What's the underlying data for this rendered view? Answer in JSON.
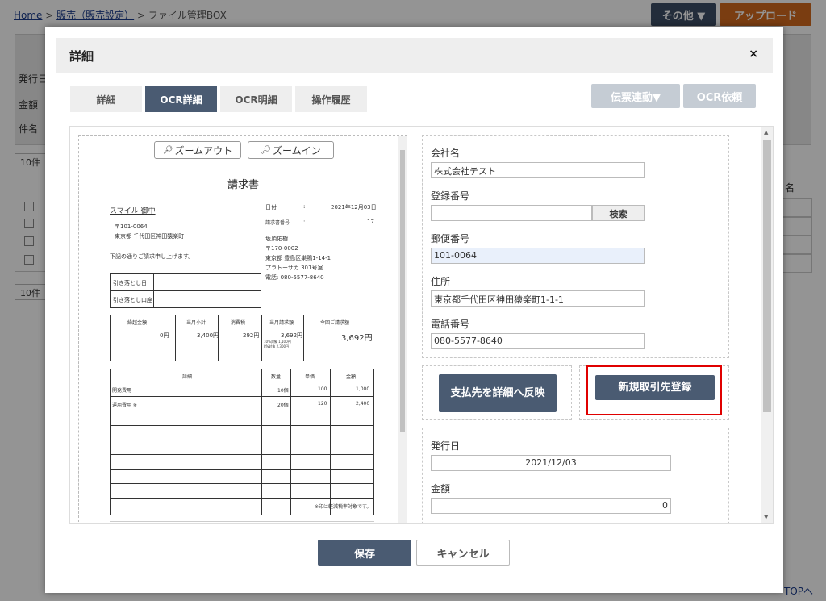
{
  "breadcrumb": {
    "home": "Home",
    "sep1": ">",
    "sales": "販売（販売設定）",
    "sep2": ">",
    "current": "ファイル管理BOX"
  },
  "header_buttons": {
    "other": "その他 ▼",
    "upload": "アップロード"
  },
  "background": {
    "labels": [
      "発行日",
      "金額",
      "件名"
    ],
    "per_page": "10件",
    "per_page2": "10件",
    "col_partial": "名",
    "to_top": "TOPへ"
  },
  "modal": {
    "title": "詳細",
    "close": "×",
    "tabs": [
      {
        "label": "詳細",
        "active": false
      },
      {
        "label": "OCR詳細",
        "active": true
      },
      {
        "label": "OCR明細",
        "active": false
      },
      {
        "label": "操作履歴",
        "active": false
      }
    ],
    "actions": {
      "link_slip": "伝票連動▼",
      "ocr_request": "OCR依頼"
    }
  },
  "viewer": {
    "zoom_out": "ズームアウト",
    "zoom_in": "ズームイン",
    "doc": {
      "title": "請求書",
      "to": "スマイル 御中",
      "to_zip": "〒101-0064",
      "to_addr": "東京都 千代田区神田猿楽町",
      "greeting": "下記の通りご請求申し上げます。",
      "date_lbl": "日付",
      "colon": ":",
      "date_val": "2021年12月03日",
      "no_lbl": "請求書番号",
      "no_val": "17",
      "issuer": "坂頂佑樹",
      "issuer_zip": "〒170-0002",
      "issuer_addr": "東京都 豊島区巣鴨1-14-1",
      "issuer_bldg": "プラトーサカ 301号室",
      "issuer_tel": "電話: 080-5577-8640",
      "deadline_lbl": "引き落とし日",
      "deadline_acct": "引き落とし口座",
      "sum_headers": [
        "繰越金額",
        "当月小計",
        "消費税",
        "当月請求額",
        "今回ご請求額"
      ],
      "sum_values": [
        "0円",
        "3,400円",
        "292円",
        "3,692円",
        "3,692円"
      ],
      "sum_sub1": "10%対象  1,100円",
      "sum_sub2": "8%対象  2,300円",
      "line_headers": [
        "詳細",
        "数量",
        "単価",
        "金額"
      ],
      "lines": [
        {
          "desc": "開発費用",
          "qty": "10個",
          "price": "100",
          "amount": "1,000"
        },
        {
          "desc": "運用費用 ※",
          "qty": "20個",
          "price": "120",
          "amount": "2,400"
        }
      ],
      "note": "※印は軽減税率対象です。"
    }
  },
  "form": {
    "company_lbl": "会社名",
    "company_val": "株式会社テスト",
    "reg_lbl": "登録番号",
    "reg_val": "",
    "search_btn": "検索",
    "zip_lbl": "郵便番号",
    "zip_val": "101-0064",
    "addr_lbl": "住所",
    "addr_val": "東京都千代田区神田猿楽町1-1-1",
    "tel_lbl": "電話番号",
    "tel_val": "080-5577-8640",
    "reflect_btn": "支払先を詳細へ反映",
    "new_partner_btn": "新規取引先登録",
    "issue_lbl": "発行日",
    "issue_val": "2021/12/03",
    "amount_lbl": "金額",
    "amount_val": "0"
  },
  "footer": {
    "save": "保存",
    "cancel": "キャンセル"
  },
  "colors": {
    "primary": "#4a5b72",
    "upload": "#d2691e",
    "highlight": "#e00000",
    "disabled": "#c5ccd4"
  }
}
